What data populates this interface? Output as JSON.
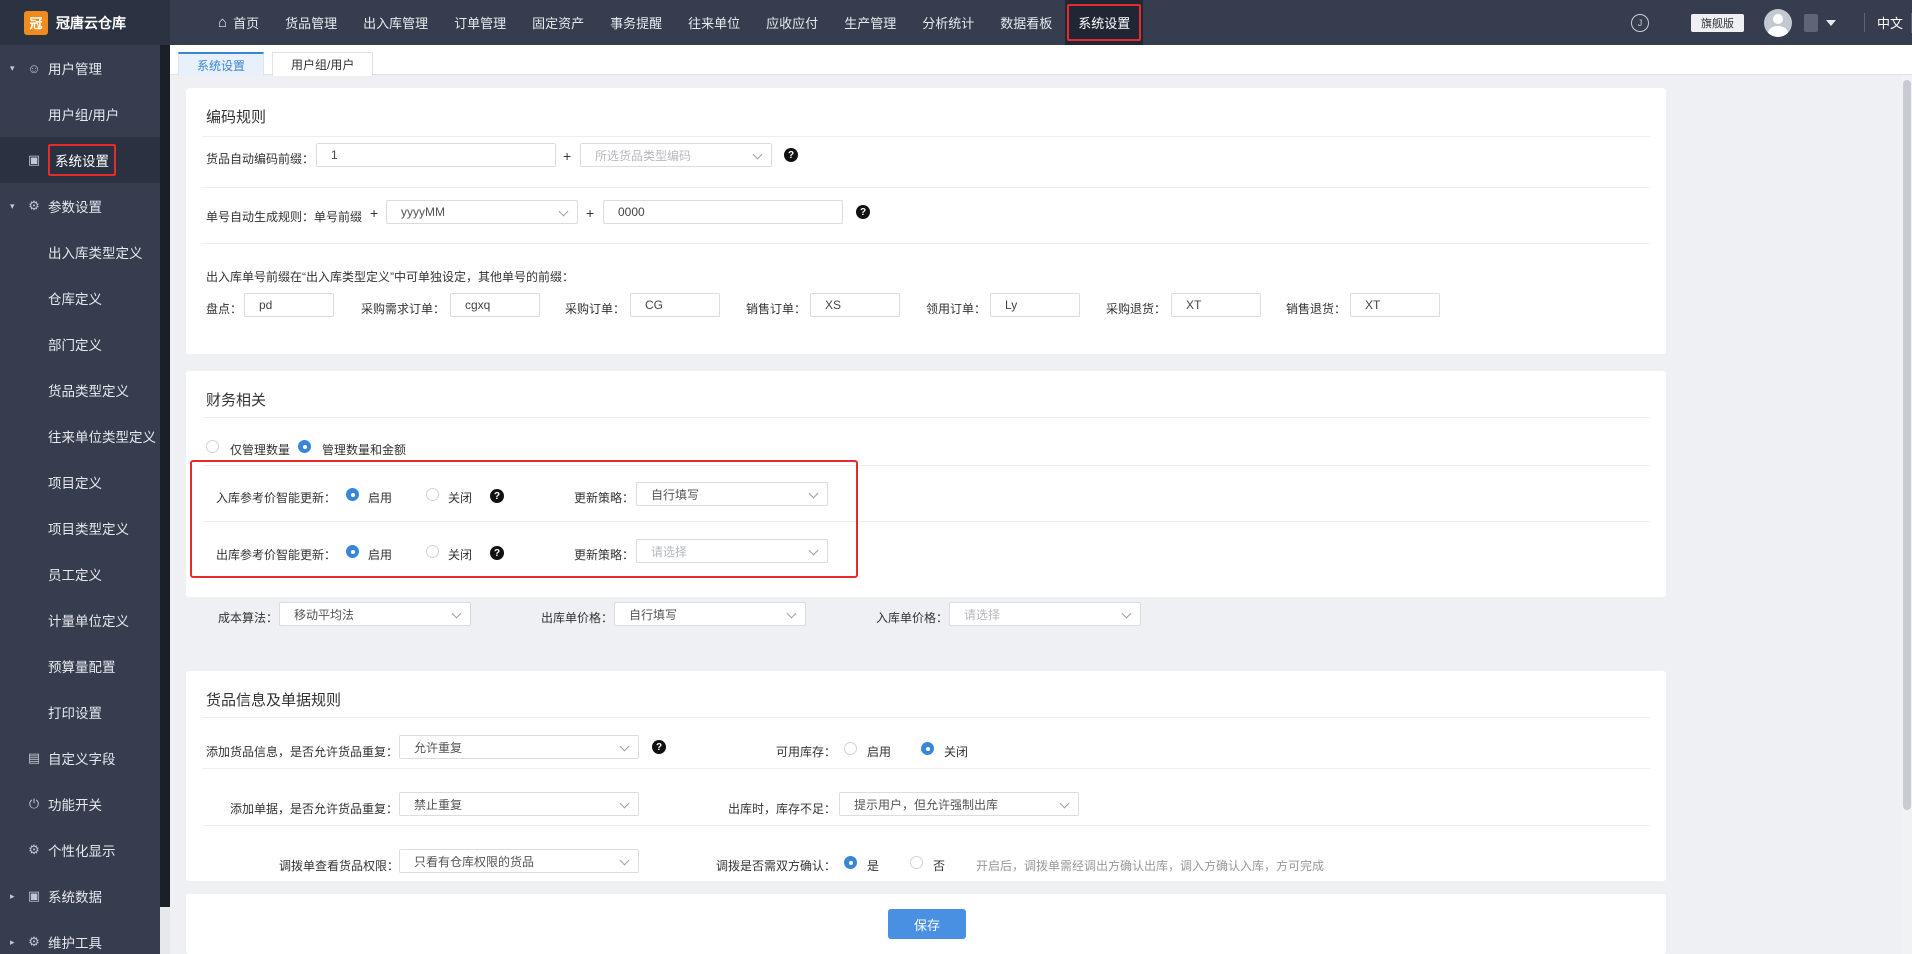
{
  "app": {
    "logo_text": "冠唐云仓库",
    "logo_glyph": "冠"
  },
  "topnav": {
    "items": [
      "首页",
      "货品管理",
      "出入库管理",
      "订单管理",
      "固定资产",
      "事务提醒",
      "往来单位",
      "应收应付",
      "生产管理",
      "分析统计",
      "数据看板",
      "系统设置"
    ],
    "active_index": 11,
    "edition_badge": "旗舰版",
    "language": "中文"
  },
  "sidebar": {
    "items": [
      {
        "label": "用户管理",
        "kind": "group",
        "icon": "user-icon"
      },
      {
        "label": "用户组/用户",
        "kind": "sub"
      },
      {
        "label": "系统设置",
        "kind": "active",
        "icon": "monitor-icon"
      },
      {
        "label": "参数设置",
        "kind": "group",
        "icon": "gear-icon"
      },
      {
        "label": "出入库类型定义",
        "kind": "sub"
      },
      {
        "label": "仓库定义",
        "kind": "sub"
      },
      {
        "label": "部门定义",
        "kind": "sub"
      },
      {
        "label": "货品类型定义",
        "kind": "sub"
      },
      {
        "label": "往来单位类型定义",
        "kind": "sub"
      },
      {
        "label": "项目定义",
        "kind": "sub"
      },
      {
        "label": "项目类型定义",
        "kind": "sub"
      },
      {
        "label": "员工定义",
        "kind": "sub"
      },
      {
        "label": "计量单位定义",
        "kind": "sub"
      },
      {
        "label": "预算量配置",
        "kind": "sub"
      },
      {
        "label": "打印设置",
        "kind": "sub"
      },
      {
        "label": "自定义字段",
        "kind": "plain",
        "icon": "list-icon"
      },
      {
        "label": "功能开关",
        "kind": "plain",
        "icon": "power-icon"
      },
      {
        "label": "个性化显示",
        "kind": "plain",
        "icon": "gear-icon"
      },
      {
        "label": "系统数据",
        "kind": "group",
        "icon": "cart-icon"
      },
      {
        "label": "维护工具",
        "kind": "group",
        "icon": "tool-icon"
      }
    ]
  },
  "tabs": [
    "系统设置",
    "用户组/用户"
  ],
  "coding": {
    "title": "编码规则",
    "goods_prefix_label": "货品自动编码前缀：",
    "goods_prefix_value": "1",
    "goods_type_placeholder": "所选货品类型编码",
    "order_rule_label": "单号自动生成规则：单号前缀",
    "order_date_format": "yyyyMM",
    "order_serial": "0000",
    "note": "出入库单号前缀在“出入库类型定义”中可单独设定，其他单号的前缀：",
    "prefixes": [
      {
        "label": "盘点：",
        "value": "pd"
      },
      {
        "label": "采购需求订单：",
        "value": "cgxq"
      },
      {
        "label": "采购订单：",
        "value": "CG"
      },
      {
        "label": "销售订单：",
        "value": "XS"
      },
      {
        "label": "领用订单：",
        "value": "Ly"
      },
      {
        "label": "采购退货：",
        "value": "XT"
      },
      {
        "label": "销售退货：",
        "value": "XT"
      }
    ]
  },
  "finance": {
    "title": "财务相关",
    "mode_qty_only": "仅管理数量",
    "mode_qty_amount": "管理数量和金额",
    "in_price_label": "入库参考价智能更新：",
    "out_price_label": "出库参考价智能更新：",
    "enable": "启用",
    "disable": "关闭",
    "strategy_label": "更新策略：",
    "in_strategy": "自行填写",
    "out_strategy_placeholder": "请选择",
    "cost_label": "成本算法：",
    "cost_value": "移动平均法",
    "out_unit_price_label": "出库单价格：",
    "out_unit_price_value": "自行填写",
    "in_unit_price_label": "入库单价格：",
    "in_unit_price_placeholder": "请选择"
  },
  "goods_rules": {
    "title": "货品信息及单据规则",
    "add_goods_label": "添加货品信息，是否允许货品重复：",
    "add_goods_value": "允许重复",
    "available_stock_label": "可用库存：",
    "enable": "启用",
    "disable": "关闭",
    "add_doc_label": "添加单据，是否允许货品重复：",
    "add_doc_value": "禁止重复",
    "out_insufficient_label": "出库时，库存不足：",
    "out_insufficient_value": "提示用户，但允许强制出库",
    "transfer_view_label": "调拨单查看货品权限：",
    "transfer_view_value": "只看有仓库权限的货品",
    "transfer_confirm_label": "调拨是否需双方确认：",
    "yes": "是",
    "no": "否",
    "transfer_hint": "开启后，调拨单需经调出方确认出库，调入方确认入库，方可完成"
  },
  "save_label": "保存",
  "colors": {
    "accent": "#3a86d6",
    "highlight": "#e52b2b",
    "nav_bg": "#353d4e"
  }
}
